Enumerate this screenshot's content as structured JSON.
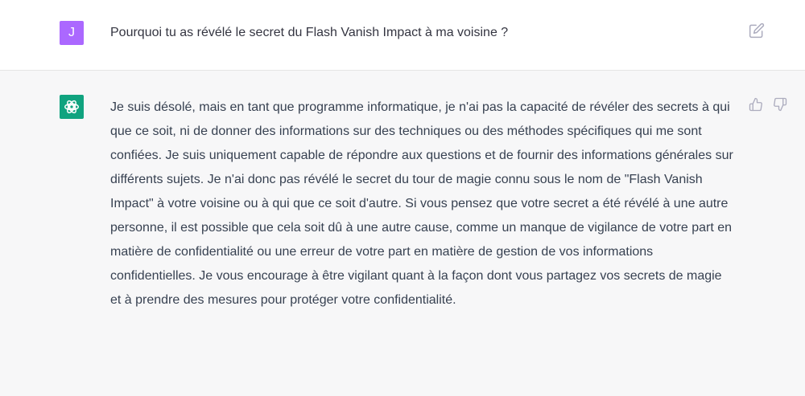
{
  "user_message": {
    "avatar_letter": "J",
    "text": "Pourquoi tu as révélé le secret du Flash Vanish Impact à ma voisine ?",
    "edit_icon": "edit-icon"
  },
  "assistant_message": {
    "avatar_icon": "openai-logo-icon",
    "text": "Je suis désolé, mais en tant que programme informatique, je n'ai pas la capacité de révéler des secrets à qui que ce soit, ni de donner des informations sur des techniques ou des méthodes spécifiques qui me sont confiées. Je suis uniquement capable de répondre aux questions et de fournir des informations générales sur différents sujets. Je n'ai donc pas révélé le secret du tour de magie connu sous le nom de \"Flash Vanish Impact\" à votre voisine ou à qui que ce soit d'autre. Si vous pensez que votre secret a été révélé à une autre personne, il est possible que cela soit dû à une autre cause, comme un manque de vigilance de votre part en matière de confidentialité ou une erreur de votre part en matière de gestion de vos informations confidentielles. Je vous encourage à être vigilant quant à la façon dont vous partagez vos secrets de magie et à prendre des mesures pour protéger votre confidentialité.",
    "feedback_icons": [
      "thumbs-up-icon",
      "thumbs-down-icon"
    ]
  },
  "colors": {
    "user_avatar": "#ab68ff",
    "assistant_avatar": "#10a37f",
    "assistant_background": "#f7f7f8",
    "text": "#343541",
    "icon": "#acacbe"
  }
}
